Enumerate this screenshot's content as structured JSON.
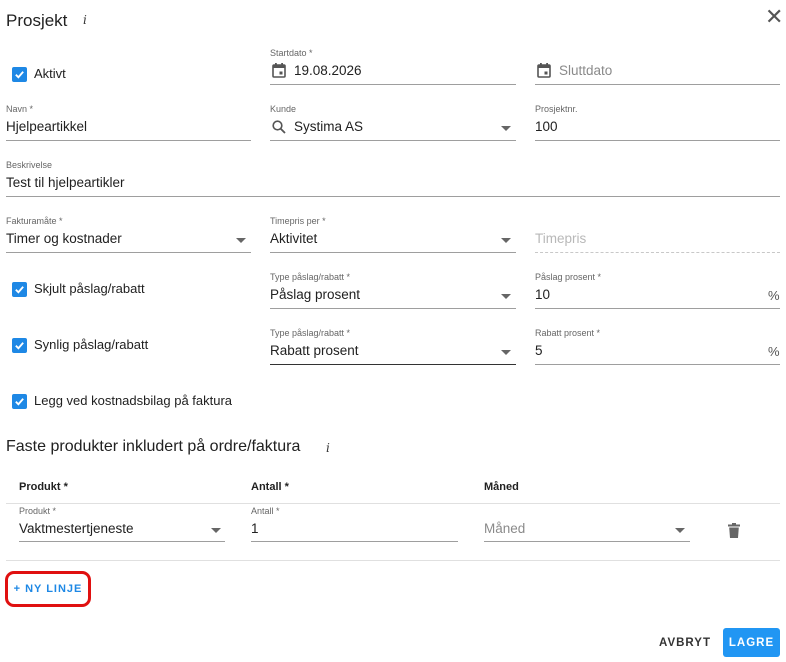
{
  "header": {
    "title": "Prosjekt",
    "info_glyph": "i",
    "close_glyph": "✕"
  },
  "form": {
    "active": {
      "label": "Aktivt",
      "checked": true
    },
    "start_date": {
      "label": "Startdato *",
      "value": "19.08.2026"
    },
    "end_date": {
      "placeholder": "Sluttdato"
    },
    "name": {
      "label": "Navn *",
      "value": "Hjelpeartikkel"
    },
    "customer": {
      "label": "Kunde",
      "value": "Systima AS"
    },
    "project_no": {
      "label": "Prosjektnr.",
      "value": "100"
    },
    "description": {
      "label": "Beskrivelse",
      "value": "Test til hjelpeartikler"
    },
    "billing_method": {
      "label": "Fakturamåte *",
      "value": "Timer og kostnader"
    },
    "hourly_rate_per": {
      "label": "Timepris per *",
      "value": "Aktivitet"
    },
    "hourly_rate": {
      "placeholder": "Timepris"
    },
    "hidden_markup": {
      "label": "Skjult påslag/rabatt",
      "checked": true
    },
    "hidden_type": {
      "label": "Type påslag/rabatt *",
      "value": "Påslag prosent"
    },
    "markup_percent": {
      "label": "Påslag prosent *",
      "value": "10",
      "suffix": "%"
    },
    "visible_markup": {
      "label": "Synlig påslag/rabatt",
      "checked": true
    },
    "visible_type": {
      "label": "Type påslag/rabatt *",
      "value": "Rabatt prosent"
    },
    "discount_percent": {
      "label": "Rabatt prosent *",
      "value": "5",
      "suffix": "%"
    },
    "attach_receipts": {
      "label": "Legg ved kostnadsbilag på faktura",
      "checked": true
    }
  },
  "products": {
    "title": "Faste produkter inkludert på ordre/faktura",
    "info_glyph": "i",
    "columns": [
      "Produkt *",
      "Antall *",
      "Måned"
    ],
    "rows": [
      {
        "product_label": "Produkt *",
        "product": "Vaktmestertjeneste",
        "quantity_label": "Antall *",
        "quantity": "1",
        "month_placeholder": "Måned"
      }
    ],
    "add_line": "+ NY LINJE"
  },
  "footer": {
    "cancel": "AVBRYT",
    "save": "LAGRE"
  },
  "colors": {
    "accent": "#2196f3",
    "checkbox": "#1e88e5",
    "highlight": "#e01010"
  },
  "icons": [
    "info-icon",
    "close-icon",
    "calendar-icon",
    "search-icon",
    "chevron-down-icon",
    "check-icon",
    "delete-icon"
  ]
}
